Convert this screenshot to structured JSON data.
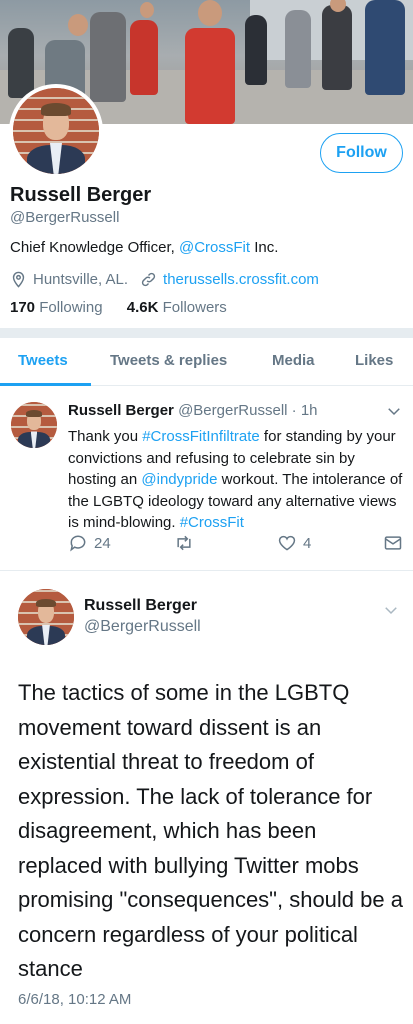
{
  "profile": {
    "name": "Russell Berger",
    "handle": "@BergerRussell",
    "follow_label": "Follow",
    "bio_prefix": "Chief Knowledge Officer, ",
    "bio_link": "@CrossFit",
    "bio_suffix": " Inc.",
    "location": "Huntsville, AL.",
    "website": "therussells.crossfit.com",
    "following_count": "170",
    "following_label": "Following",
    "followers_count": "4.6K",
    "followers_label": "Followers"
  },
  "tabs": [
    "Tweets",
    "Tweets & replies",
    "Media",
    "Likes"
  ],
  "tweet1": {
    "name": "Russell Berger",
    "handle": "@BergerRussell",
    "time": " · 1h",
    "body": [
      {
        "text": "Thank you ",
        "link": false
      },
      {
        "text": "#CrossFitInfiltrate",
        "link": true
      },
      {
        "text": " for standing by your convictions and refusing to celebrate sin by hosting an ",
        "link": false
      },
      {
        "text": "@indypride",
        "link": true
      },
      {
        "text": " workout. The intolerance of the LGBTQ ideology toward any alternative views is mind-blowing. ",
        "link": false
      },
      {
        "text": "#CrossFit",
        "link": true
      }
    ],
    "replies": "24",
    "likes": "4"
  },
  "tweet2": {
    "name": "Russell Berger",
    "handle": "@BergerRussell",
    "body": "The tactics of some in the LGBTQ movement toward dissent is an existential threat to freedom of expression. The lack of tolerance for disagreement, which has been replaced with bullying Twitter mobs promising \"consequences\", should be a concern regardless of your political stance",
    "timestamp": "6/6/18, 10:12 AM"
  },
  "colors": {
    "accent": "#1da1f2",
    "secondary_text": "#657786",
    "separator": "#e6ecf0"
  },
  "icons": [
    "location-icon",
    "link-icon",
    "reply-icon",
    "retweet-icon",
    "like-icon",
    "message-icon",
    "chevron-down-icon"
  ]
}
